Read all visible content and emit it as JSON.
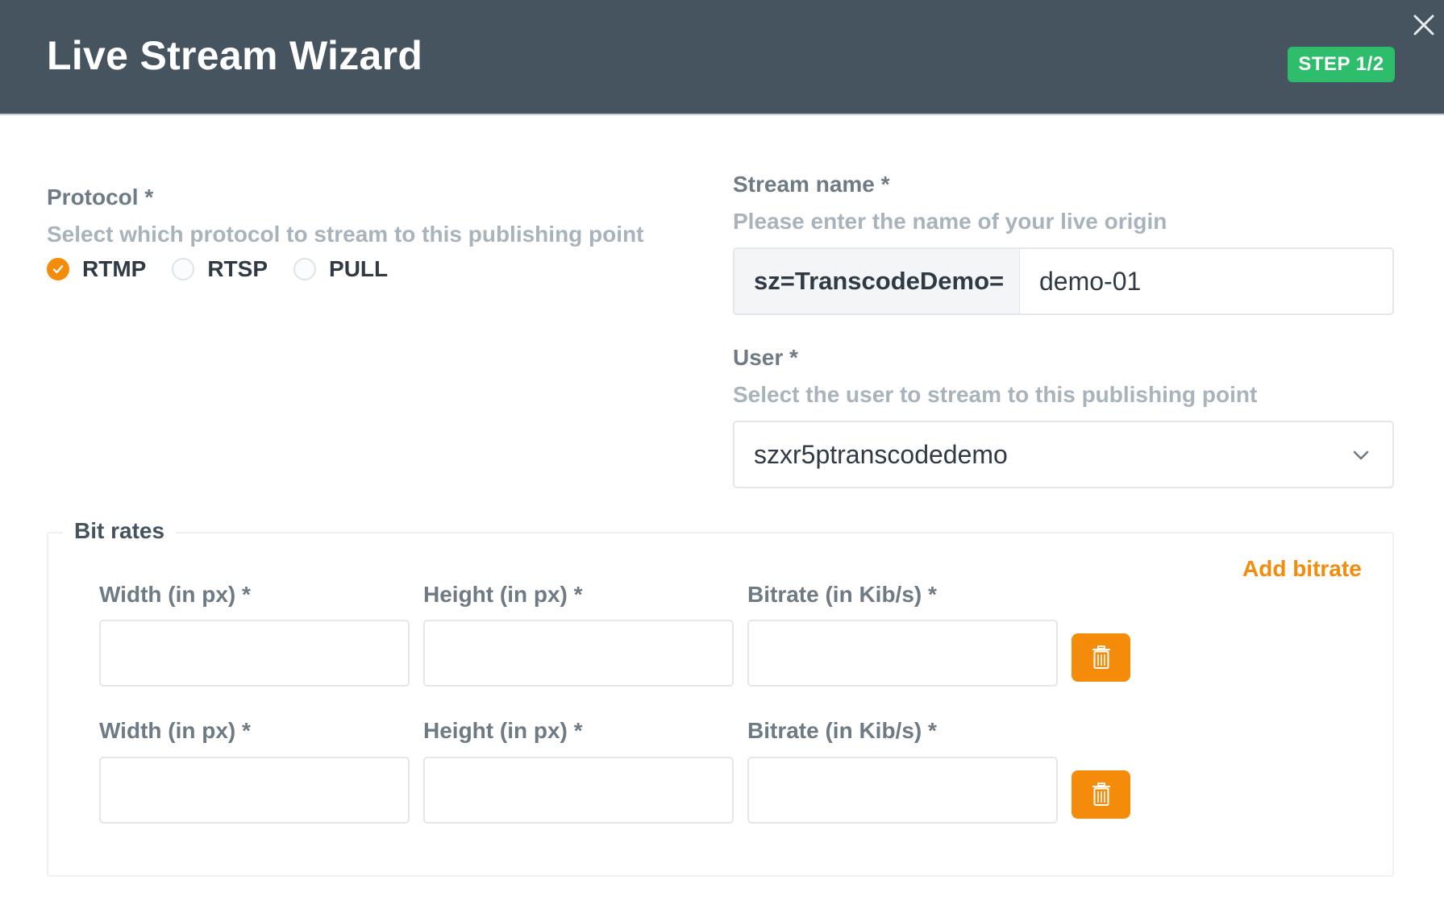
{
  "header": {
    "title": "Live Stream Wizard",
    "step": "STEP 1/2"
  },
  "protocol": {
    "label": "Protocol *",
    "help": "Select which protocol to stream to this publishing point",
    "options": [
      "RTMP",
      "RTSP",
      "PULL"
    ],
    "selected": "RTMP"
  },
  "stream_name": {
    "label": "Stream name *",
    "help": "Please enter the name of your live origin",
    "prefix": "sz=TranscodeDemo=",
    "value": "demo-01"
  },
  "user": {
    "label": "User *",
    "help": "Select the user to stream to this publishing point",
    "selected": "szxr5ptranscodedemo"
  },
  "bitrates": {
    "legend": "Bit rates",
    "add_label": "Add bitrate",
    "rows": [
      {
        "width_label": "Width (in px) *",
        "height_label": "Height (in px) *",
        "bitrate_label": "Bitrate (in Kib/s) *",
        "width": "",
        "height": "",
        "bitrate": ""
      },
      {
        "width_label": "Width (in px) *",
        "height_label": "Height (in px) *",
        "bitrate_label": "Bitrate (in Kib/s) *",
        "width": "",
        "height": "",
        "bitrate": ""
      }
    ]
  },
  "colors": {
    "header_bg": "#46545f",
    "step_badge": "#2ebd6a",
    "accent": "#f58b0a"
  }
}
